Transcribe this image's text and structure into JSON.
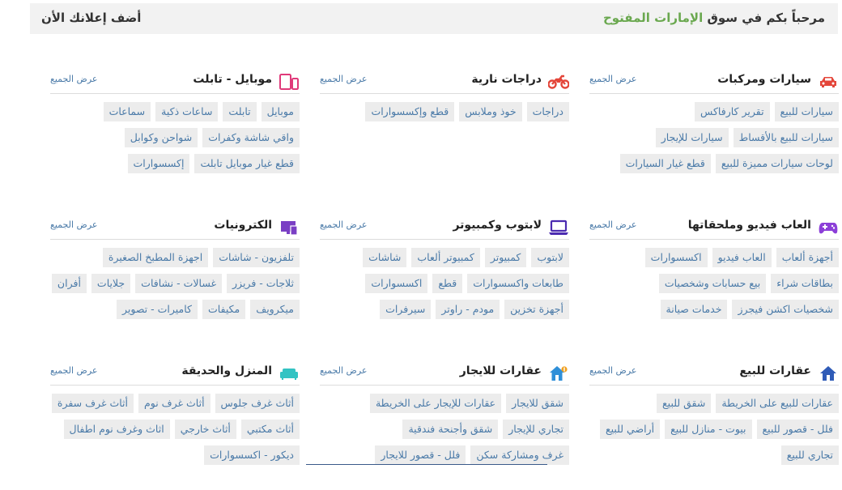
{
  "header": {
    "welcome_prefix": "مرحباً بكم في سوق",
    "welcome_highlight": "الإمارات المفتوح",
    "post_ad": "أضف إعلانك الأن",
    "highlight_color": "#6aa84f"
  },
  "categories": [
    {
      "title": "سيارات ومركبات",
      "icon": "car-icon",
      "view_all": "عرض الجميع",
      "tags": [
        "سيارات للبيع",
        "تقرير كارفاكس",
        "سيارات للبيع بالأقساط",
        "سيارات للإيجار",
        "لوحات سيارات مميزة للبيع",
        "قطع غيار السيارات"
      ]
    },
    {
      "title": "دراجات نارية",
      "icon": "motorcycle-icon",
      "view_all": "عرض الجميع",
      "tags": [
        "دراجات",
        "خوذ وملابس",
        "قطع وإكسسوارات"
      ]
    },
    {
      "title": "موبايل - تابلت",
      "icon": "mobile-tablet-icon",
      "view_all": "عرض الجميع",
      "tags": [
        "موبايل",
        "تابلت",
        "ساعات ذكية",
        "سماعات",
        "واقي شاشة وكفرات",
        "شواحن وكوابل",
        "قطع غيار موبايل تابلت",
        "إكسسوارات"
      ]
    },
    {
      "title": "العاب فيديو وملحقاتها",
      "icon": "gamepad-icon",
      "view_all": "عرض الجميع",
      "tags": [
        "أجهزة ألعاب",
        "العاب فيديو",
        "اكسسوارات",
        "بطاقات شراء",
        "بيع حسابات وشخصيات",
        "شخصيات اكشن فيجرز",
        "خدمات صيانة"
      ]
    },
    {
      "title": "لابتوب وكمبيوتر",
      "icon": "laptop-icon",
      "view_all": "عرض الجميع",
      "tags": [
        "لابتوب",
        "كمبيوتر",
        "كمبيوتر ألعاب",
        "شاشات",
        "طابعات واكسسوارات",
        "قطع",
        "اكسسوارات",
        "أجهزة تخزين",
        "مودم - راوتر",
        "سيرفرات"
      ]
    },
    {
      "title": "الكترونيات",
      "icon": "electronics-icon",
      "view_all": "عرض الجميع",
      "tags": [
        "تلفزيون - شاشات",
        "اجهزة المطبخ الصغيرة",
        "ثلاجات - فريزر",
        "غسالات - نشافات",
        "جلايات",
        "أفران",
        "ميكرويف",
        "مكيفات",
        "كاميرات - تصوير"
      ]
    },
    {
      "title": "عقارات للبيع",
      "icon": "house-icon",
      "view_all": "عرض الجميع",
      "tags": [
        "عقارات للبيع على الخريطة",
        "شقق للبيع",
        "فلل - قصور للبيع",
        "بيوت - منازل للبيع",
        "أراضي للبيع",
        "تجاري للبيع"
      ]
    },
    {
      "title": "عقارات للايجار",
      "icon": "house-rent-icon",
      "view_all": "عرض الجميع",
      "tags": [
        "شقق للايجار",
        "عقارات للإيجار على الخريطة",
        "تجاري للإيجار",
        "شقق وأجنحة فندقية",
        "غرف ومشاركة سكن",
        "فلل - قصور للايجار"
      ]
    },
    {
      "title": "المنزل والحديقة",
      "icon": "sofa-icon",
      "view_all": "عرض الجميع",
      "tags": [
        "أثاث غرف جلوس",
        "أثاث غرف نوم",
        "أثاث غرف سفرة",
        "أثاث مكتبي",
        "أثاث خارجي",
        "اثاث وغرف نوم اطفال",
        "ديكور - اكسسوارات"
      ]
    }
  ]
}
